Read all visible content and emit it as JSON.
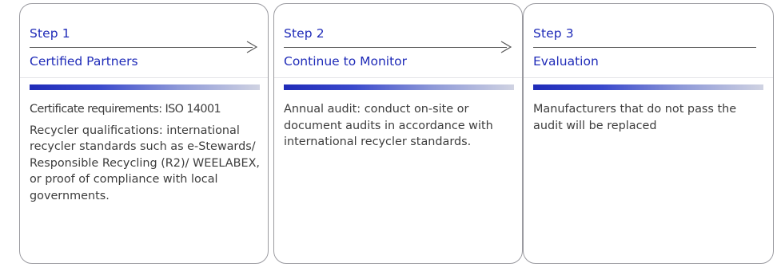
{
  "steps": [
    {
      "step_label": "Step 1",
      "title": "Certified Partners",
      "paragraphs": [
        "Certificate requirements: ISO 14001",
        "Recycler qualifications: international recycler standards such as e-Stewards/ Responsible Recycling (R2)/ WEELABEX, or proof of compliance with local governments."
      ],
      "connector_icon": "arrow-right-icon"
    },
    {
      "step_label": "Step 2",
      "title": "Continue to Monitor",
      "paragraphs": [
        "Annual audit: conduct on-site or document audits in accordance with international recycler standards."
      ],
      "connector_icon": "arrow-right-icon"
    },
    {
      "step_label": "Step 3",
      "title": "Evaluation",
      "paragraphs": [
        "Manufacturers that do not pass the audit will be replaced"
      ]
    }
  ],
  "colors": {
    "accent": "#1f2bb8",
    "text": "#3d3d3d",
    "border": "#9a9aa0",
    "gradient_start": "#1f2bb8",
    "gradient_end": "#d0d3e2"
  }
}
